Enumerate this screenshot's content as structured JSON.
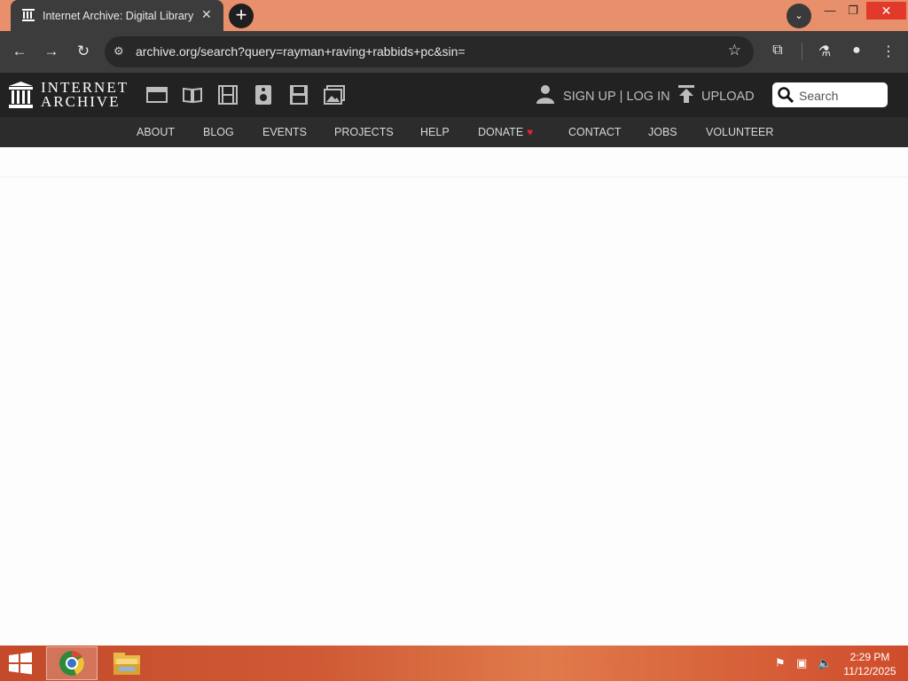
{
  "browser": {
    "tab_title": "Internet Archive: Digital Library",
    "url": "archive.org/search?query=rayman+raving+rabbids+pc&sin=",
    "icons": [
      "archive-favicon",
      "close-icon",
      "plus-icon",
      "chevron-down-icon",
      "back-icon",
      "forward-icon",
      "reload-icon",
      "site-info-icon",
      "star-icon",
      "extensions-icon",
      "labs-icon",
      "profile-icon",
      "menu-icon"
    ]
  },
  "ia": {
    "logo_line1": "INTERNET",
    "logo_line2": "ARCHIVE",
    "media_icons": [
      "web-icon",
      "texts-icon",
      "video-icon",
      "audio-icon",
      "software-icon",
      "images-icon"
    ],
    "signup": "SIGN UP",
    "login": "LOG IN",
    "sep": "|",
    "upload": "UPLOAD",
    "search_placeholder": "Search",
    "nav": [
      "ABOUT",
      "BLOG",
      "EVENTS",
      "PROJECTS",
      "HELP",
      "DONATE",
      "CONTACT",
      "JOBS",
      "VOLUNTEER"
    ]
  },
  "taskbar": {
    "time": "2:29 PM",
    "date": "11/12/2025"
  },
  "colors": {
    "tabstrip": "#e8906c",
    "chrome": "#3c3c3c",
    "ia_header": "#222222",
    "ia_nav": "#2c2c2c",
    "heart": "#e0262c"
  }
}
